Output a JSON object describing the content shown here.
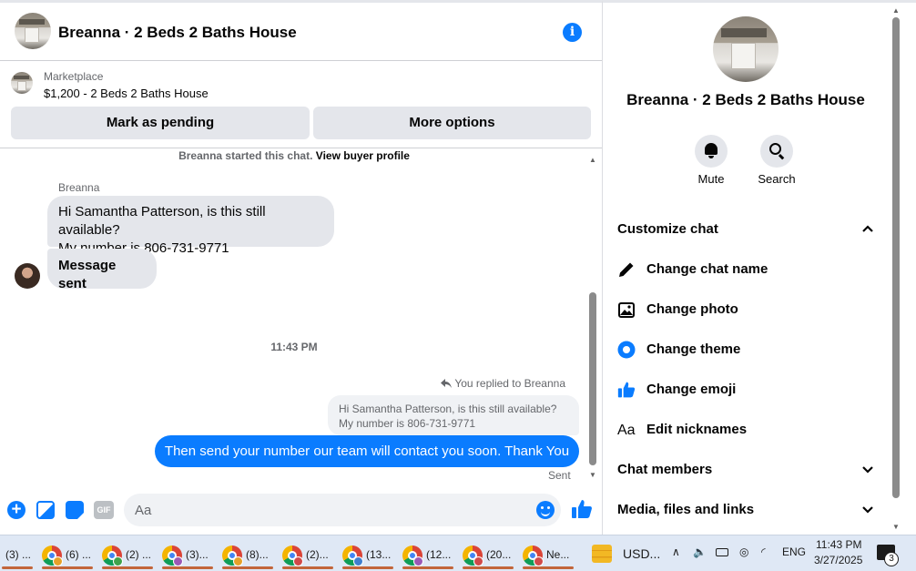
{
  "header": {
    "title": "Breanna · 2 Beds 2 Baths House"
  },
  "marketplace": {
    "label": "Marketplace",
    "listing": "$1,200 - 2 Beds 2 Baths House",
    "mark_pending": "Mark as pending",
    "more_options": "More options"
  },
  "chat": {
    "started_text": "Breanna started this chat.",
    "view_profile": "View buyer profile",
    "sender_name": "Breanna",
    "msg1_line1": "Hi Samantha Patterson, is this still available?",
    "msg1_line2": "My number is 806-731-9771",
    "msg2": "Message sent",
    "time_separator": "11:43 PM",
    "replied_to": "You replied to Breanna",
    "quoted_line1": "Hi Samantha Patterson, is this still available?",
    "quoted_line2": "My number is 806-731-9771",
    "reply": "Then send your number our team will contact you soon. Thank You",
    "status": "Sent"
  },
  "composer": {
    "placeholder": "Aa",
    "gif_label": "GIF"
  },
  "details": {
    "title": "Breanna · 2 Beds 2 Baths House",
    "mute_label": "Mute",
    "search_label": "Search",
    "customize_chat": "Customize chat",
    "items": [
      {
        "label": "Change chat name",
        "icon": "pencil-icon"
      },
      {
        "label": "Change photo",
        "icon": "photo-icon"
      },
      {
        "label": "Change theme",
        "icon": "theme-icon"
      },
      {
        "label": "Change emoji",
        "icon": "thumbs-up-icon"
      },
      {
        "label": "Edit nicknames",
        "icon": "nickname-icon",
        "glyph": "Aa"
      }
    ],
    "chat_members": "Chat members",
    "media_files": "Media, files and links"
  },
  "taskbar": {
    "tasks": [
      "(3) ...",
      "(6) ...",
      "(2) ...",
      "(3)...",
      "(8)...",
      "(2)...",
      "(13...",
      "(12...",
      "(20...",
      "Ne..."
    ],
    "badge_colors": [
      "#e5a22a",
      "#3fa34d",
      "#9b59b6",
      "#e5a22a",
      "#d04a4a",
      "#3f7fd0",
      "#9b59b6",
      "#d04a4a",
      "#d04a4a"
    ],
    "currency": "USD...",
    "language": "ENG",
    "time": "11:43 PM",
    "date": "3/27/2025",
    "notifications": "3"
  },
  "colors": {
    "accent": "#0a7cff",
    "bubble_in": "#e4e6eb",
    "taskbar": "#dfe8f5"
  }
}
